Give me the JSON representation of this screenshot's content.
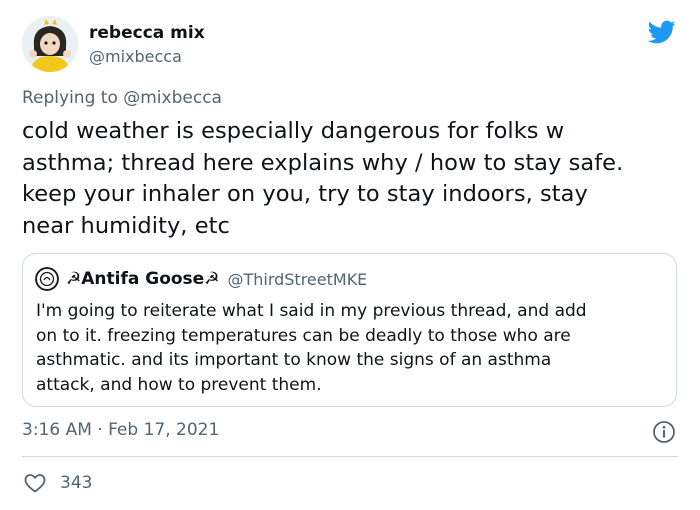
{
  "author": {
    "display_name": "rebecca mix",
    "handle": "@mixbecca"
  },
  "reply_context": {
    "prefix": "Replying to",
    "mention": "@mixbecca"
  },
  "tweet_text": "cold weather is especially dangerous for folks w\nasthma; thread here explains why / how to stay safe.\nkeep your inhaler on you, try to stay indoors, stay\nnear humidity, etc",
  "quoted_tweet": {
    "display_name": "☭Antifa Goose☭",
    "handle": "@ThirdStreetMKE",
    "text": "I'm going to reiterate what I said in my previous thread, and add\non to it.  freezing temperatures can be deadly to those who are\nasthmatic. and its important to know the signs of an asthma\nattack, and how to prevent them."
  },
  "timestamp": "3:16 AM · Feb 17, 2021",
  "engagement": {
    "likes": "343"
  },
  "icons": {
    "brand": "twitter-bird-icon",
    "info": "info-icon",
    "like": "heart-icon"
  },
  "colors": {
    "brand_blue": "#1d9bf0",
    "secondary_text": "#536471",
    "border": "#cfd9de",
    "primary_text": "#0f1419"
  }
}
